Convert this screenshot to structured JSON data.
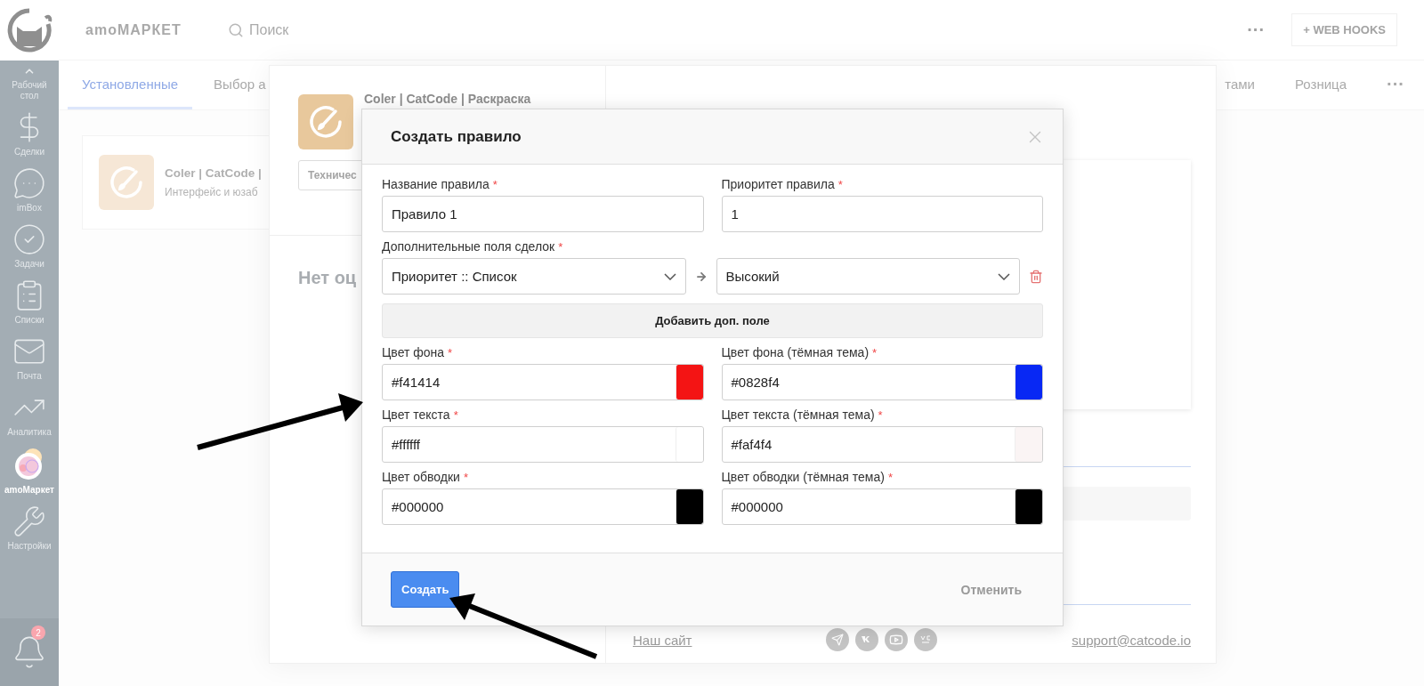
{
  "sidebar": {
    "items": [
      {
        "kind": "desk",
        "label": "Рабочий\nстол",
        "selected": false
      },
      {
        "kind": "deals",
        "label": "Сделки",
        "selected": false
      },
      {
        "kind": "inbox",
        "label": "imBox",
        "selected": false
      },
      {
        "kind": "tasks",
        "label": "Задачи",
        "selected": false
      },
      {
        "kind": "lists",
        "label": "Списки",
        "selected": false
      },
      {
        "kind": "mail",
        "label": "Почта",
        "selected": false
      },
      {
        "kind": "analytics",
        "label": "Аналитика",
        "selected": false
      },
      {
        "kind": "market",
        "label": "amoМаркет",
        "selected": true
      },
      {
        "kind": "settings",
        "label": "Настройки",
        "selected": false
      }
    ],
    "notifications": {
      "count": "2"
    }
  },
  "topbar": {
    "brand": "amoМАРКЕТ",
    "search": {
      "placeholder": "Поиск"
    },
    "more": "···",
    "button": "+ WEB HOOKS"
  },
  "tabs": [
    {
      "label": "Установленные",
      "selected": true
    },
    {
      "label": "Выбор а",
      "selected": false
    }
  ],
  "tabs_right": [
    {
      "label": "тами",
      "selected": false
    },
    {
      "label": "Розница",
      "selected": false
    }
  ],
  "tabs_more": "···",
  "app_card": {
    "title": "Coler | CatCode |",
    "subtitle": "Интерфейс и юзаб"
  },
  "app_panel": {
    "title": "Coler | CatCode | Раскраска",
    "field": "Техничес",
    "heading": "Нет оц",
    "footer": {
      "site_link": "Наш сайт",
      "email": "support@catcode.io"
    }
  },
  "dialog": {
    "title": "Создать правило",
    "fields": [
      {
        "label": "Название правила",
        "mark": "*",
        "value": "Правило 1"
      },
      {
        "label": "Приоритет правила",
        "mark": "*",
        "value": "1"
      }
    ],
    "extra": {
      "label": "Дополнительные поля сделок",
      "mark": "*",
      "field": "Приоритет :: Список",
      "value": "Высокий"
    },
    "add_button": "Добавить доп. поле",
    "colors": [
      {
        "label": "Цвет фона",
        "mark": "*",
        "value": "#f41414",
        "color": "#f41414"
      },
      {
        "label": "Цвет фона (тёмная тема)",
        "mark": "*",
        "value": "#0828f4",
        "color": "#0828f4"
      },
      {
        "label": "Цвет текста",
        "mark": "*",
        "value": "#ffffff",
        "color": "#ffffff"
      },
      {
        "label": "Цвет текста (тёмная тема)",
        "mark": "*",
        "value": "#faf4f4",
        "color": "#faf4f4"
      },
      {
        "label": "Цвет обводки",
        "mark": "*",
        "value": "#000000",
        "color": "#000000"
      },
      {
        "label": "Цвет обводки (тёмная тема)",
        "mark": "*",
        "value": "#000000",
        "color": "#000000"
      }
    ],
    "submit": "Создать",
    "cancel": "Отменить"
  }
}
